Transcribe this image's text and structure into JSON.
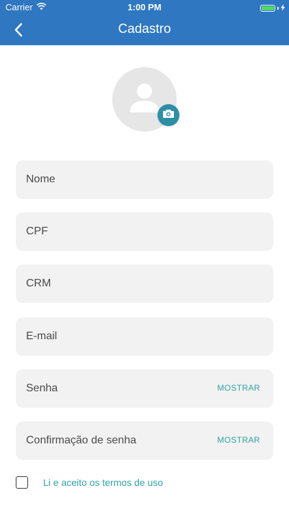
{
  "status_bar": {
    "carrier": "Carrier",
    "time": "1:00 PM"
  },
  "nav": {
    "title": "Cadastro",
    "back_icon": "chevron-left-icon"
  },
  "avatar": {
    "icon": "user-icon",
    "camera_icon": "camera-icon"
  },
  "form": {
    "nome": {
      "placeholder": "Nome",
      "value": ""
    },
    "cpf": {
      "placeholder": "CPF",
      "value": ""
    },
    "crm": {
      "placeholder": "CRM",
      "value": ""
    },
    "email": {
      "placeholder": "E-mail",
      "value": ""
    },
    "senha": {
      "placeholder": "Senha",
      "value": "",
      "show_label": "MOSTRAR"
    },
    "confirmacao": {
      "placeholder": "Confirmação de senha",
      "value": "",
      "show_label": "MOSTRAR"
    }
  },
  "terms": {
    "label": "Li e aceito os termos de uso",
    "checked": false
  },
  "colors": {
    "header": "#2f77c0",
    "accent": "#2fa3a6",
    "field_bg": "#f2f2f2"
  }
}
